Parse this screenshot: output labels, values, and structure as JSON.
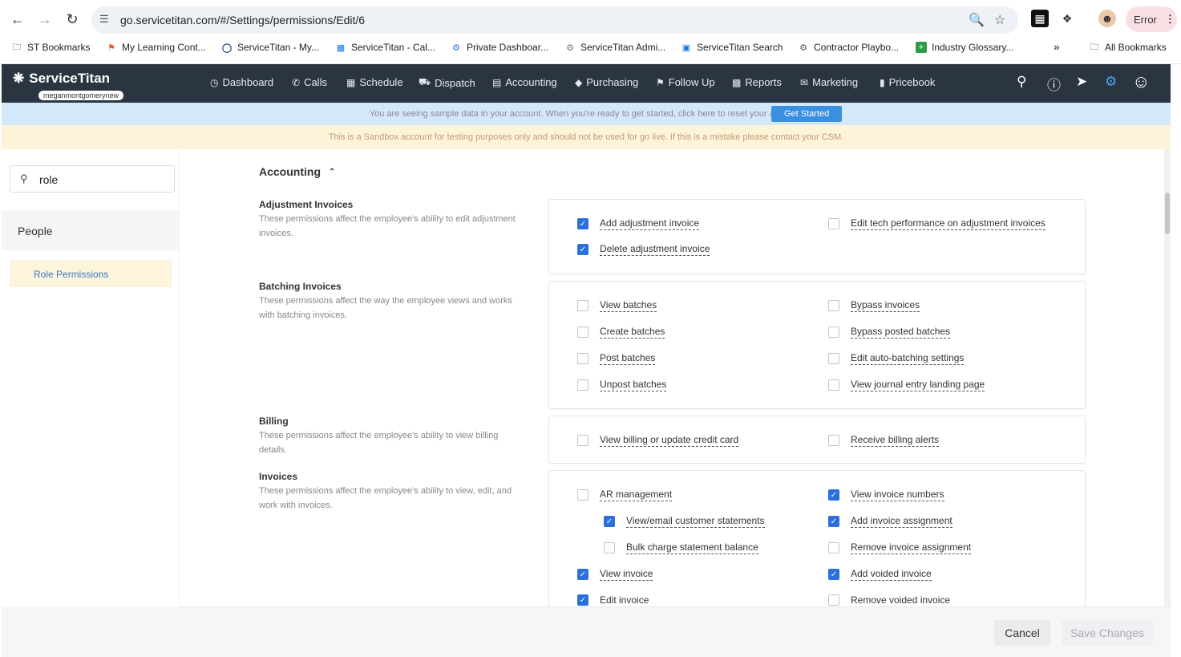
{
  "browser": {
    "url": "go.servicetitan.com/#/Settings/permissions/Edit/6",
    "error_label": "Error",
    "bookmarks": [
      {
        "label": "ST Bookmarks",
        "icon": "folder-icon"
      },
      {
        "label": "My Learning Cont...",
        "icon": "flag-icon"
      },
      {
        "label": "ServiceTitan - My...",
        "icon": "circle-icon"
      },
      {
        "label": "ServiceTitan - Cal...",
        "icon": "calendar-icon"
      },
      {
        "label": "Private Dashboar...",
        "icon": "puzzle-icon"
      },
      {
        "label": "ServiceTitan Admi...",
        "icon": "puzzle-icon"
      },
      {
        "label": "ServiceTitan Search",
        "icon": "search-icon"
      },
      {
        "label": "Contractor Playbo...",
        "icon": "puzzle-icon"
      },
      {
        "label": "Industry Glossary...",
        "icon": "plus-icon"
      }
    ],
    "more_label": "»",
    "all_bookmarks": "All Bookmarks"
  },
  "app": {
    "logo": "ServiceTitan",
    "tenant": "meganmontgomerynew",
    "nav": [
      {
        "label": "Dashboard",
        "icon": "dashboard-icon"
      },
      {
        "label": "Calls",
        "icon": "phone-icon"
      },
      {
        "label": "Schedule",
        "icon": "calendar-icon"
      },
      {
        "label": "Dispatch",
        "icon": "truck-icon"
      },
      {
        "label": "Accounting",
        "icon": "ledger-icon"
      },
      {
        "label": "Purchasing",
        "icon": "tag-icon"
      },
      {
        "label": "Follow Up",
        "icon": "flag-icon"
      },
      {
        "label": "Reports",
        "icon": "chart-icon"
      },
      {
        "label": "Marketing",
        "icon": "megaphone-icon"
      },
      {
        "label": "Pricebook",
        "icon": "book-icon"
      }
    ]
  },
  "banners": {
    "sample_text": "You are seeing sample data in your account. When you're ready to get started, click here to reset your account.",
    "get_started": "Get Started",
    "sandbox_text": "This is a Sandbox account for testing purposes only and should not be used for go live. If this is a mistake please contact your CSM."
  },
  "sidebar": {
    "search_value": "role",
    "people": "People",
    "role_permissions": "Role Permissions"
  },
  "main": {
    "section_title": "Accounting",
    "groups": [
      {
        "title": "Adjustment Invoices",
        "desc": "These permissions affect the employee's ability to edit adjustment invoices.",
        "perms": [
          {
            "label": "Add adjustment invoice",
            "checked": true
          },
          {
            "label": "Delete adjustment invoice",
            "checked": true
          },
          {
            "label": "Edit tech performance on adjustment invoices",
            "checked": false
          }
        ]
      },
      {
        "title": "Batching Invoices",
        "desc": "These permissions affect the way the employee views and works with batching invoices.",
        "perms": [
          {
            "label": "View batches",
            "checked": false
          },
          {
            "label": "Create batches",
            "checked": false
          },
          {
            "label": "Post batches",
            "checked": false
          },
          {
            "label": "Unpost batches",
            "checked": false
          },
          {
            "label": "Bypass invoices",
            "checked": false
          },
          {
            "label": "Bypass posted batches",
            "checked": false
          },
          {
            "label": "Edit auto-batching settings",
            "checked": false
          },
          {
            "label": "View journal entry landing page",
            "checked": false
          }
        ]
      },
      {
        "title": "Billing",
        "desc": "These permissions affect the employee's ability to view billing details.",
        "perms": [
          {
            "label": "View billing or update credit card",
            "checked": false
          },
          {
            "label": "Receive billing alerts",
            "checked": false
          }
        ]
      },
      {
        "title": "Invoices",
        "desc": "These permissions affect the employee's ability to view, edit, and work with invoices.",
        "perms": [
          {
            "label": "AR management",
            "checked": false
          },
          {
            "label": "View/email customer statements",
            "checked": true
          },
          {
            "label": "Bulk charge statement balance",
            "checked": false
          },
          {
            "label": "View invoice",
            "checked": true
          },
          {
            "label": "Edit invoice",
            "checked": true
          },
          {
            "label": "View invoice numbers",
            "checked": true
          },
          {
            "label": "Add invoice assignment",
            "checked": true
          },
          {
            "label": "Remove invoice assignment",
            "checked": false
          },
          {
            "label": "Add voided invoice",
            "checked": true
          },
          {
            "label": "Remove voided invoice",
            "checked": false
          }
        ]
      }
    ]
  },
  "footer": {
    "cancel": "Cancel",
    "save": "Save Changes"
  }
}
